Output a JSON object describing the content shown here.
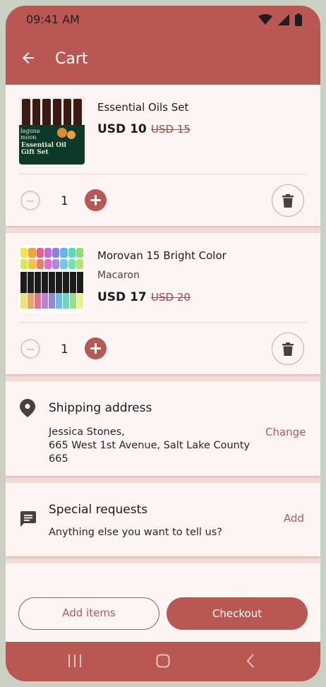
{
  "status": {
    "time": "09:41 AM",
    "icons": [
      "wifi-icon",
      "signal-icon",
      "battery-icon"
    ]
  },
  "header": {
    "title": "Cart"
  },
  "items": [
    {
      "name": "Essential Oils Set",
      "price": "USD 10",
      "old_price": "USD 15",
      "quantity": "1",
      "image_brand": "laguna moon",
      "image_label": "Essential Oil Gift Set"
    },
    {
      "name": "Morovan 15 Bright Color",
      "variant": "Macaron",
      "price": "USD 17",
      "old_price": "USD 20",
      "quantity": "1"
    }
  ],
  "shipping": {
    "title": "Shipping address",
    "name_line": "Jessica Stones,",
    "address_line": "665 West 1st Avenue, Salt Lake County",
    "zip_line": "665",
    "action": "Change"
  },
  "requests": {
    "title": "Special requests",
    "subtitle": "Anything else you want to tell us?",
    "action": "Add"
  },
  "actions": {
    "add_items": "Add items",
    "checkout": "Checkout"
  },
  "colors": {
    "primary": "#b95853",
    "surface": "#fdf5f3",
    "background": "#f1dcd9"
  }
}
